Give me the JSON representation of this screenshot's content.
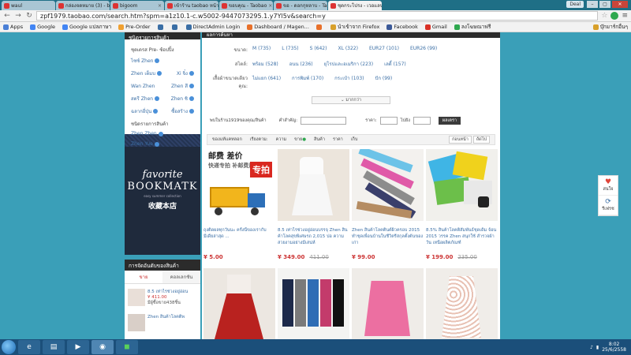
{
  "browser": {
    "tabs": [
      {
        "label": "waul",
        "active": false
      },
      {
        "label": "กล่องจดหมาย (3) - bigoom",
        "active": false
      },
      {
        "label": "bigoom",
        "active": false
      },
      {
        "label": "เข้าร้าน taobao หน้าร้านค้า",
        "active": false
      },
      {
        "label": "ขอบคุณ - Taobao",
        "active": false
      },
      {
        "label": "ขอ - ดอกกุหลาบ - Taobao",
        "active": false
      },
      {
        "label": "ชุดกระโปรง - เวอแลนด์น่า",
        "active": true
      }
    ],
    "user": "Deal",
    "url": "zpf1979.taobao.com/search.htm?spm=a1z10.1-c.w5002-9447073295.1.y7Yl5v&search=y",
    "bookmarks": [
      {
        "label": "Apps",
        "color": "#4a7fd6"
      },
      {
        "label": "Google",
        "color": "#4285f4"
      },
      {
        "label": "Google แปลภาษา",
        "color": "#4285f4"
      },
      {
        "label": "Pre-Order",
        "color": "#f0a030"
      },
      {
        "label": "",
        "color": "#3a6ea5"
      },
      {
        "label": "",
        "color": "#3a6ea5"
      },
      {
        "label": "DirectAdmin Login",
        "color": "#3a6ea5"
      },
      {
        "label": "Dashboard / Magen...",
        "color": "#e8702a"
      },
      {
        "label": "",
        "color": "#e8702a"
      },
      {
        "label": "นำเข้าจาก Firefox",
        "color": "#d8a02a"
      },
      {
        "label": "Facebook",
        "color": "#3b5998"
      },
      {
        "label": "Gmail",
        "color": "#d93025"
      },
      {
        "label": "ลงโฆษณาฟรี",
        "color": "#2fa84f"
      },
      {
        "label": "บุ๊กมาร์กอื่นๆ",
        "color": "#d8a02a"
      }
    ]
  },
  "sidebar": {
    "category_header": "ชนิดรายการสินค้า",
    "group1_title": "ชุดเดรส Pre- ซ้อปปิ้ง",
    "items": [
      {
        "label": "ไซซ์ Zhen",
        "has_icon": true
      },
      {
        "label": "Zhen เต็มบ",
        "has_icon": true
      },
      {
        "label": "Xi จิ๋ง",
        "has_icon": true
      },
      {
        "label": "Wan Zhen",
        "has_icon": false
      },
      {
        "label": "Zhen สี",
        "has_icon": true
      },
      {
        "label": "สตรี Zhen",
        "has_icon": true
      },
      {
        "label": "Zhen ชิ",
        "has_icon": true
      },
      {
        "label": "ฉลากยี่ปุ่น",
        "has_icon": true
      },
      {
        "label": "ซื้อสร้าง",
        "has_icon": true
      }
    ],
    "group2_title": "ชนิดรายการสินค้า",
    "group2_items": [
      {
        "label": "Zhen Zhen",
        "has_icon": true
      },
      {
        "label": "Zhen Yue",
        "has_icon": true
      }
    ],
    "banner": {
      "line1": "favorite",
      "line2": "BOOKMATK",
      "line3": "easy summer collection",
      "line4": "收藏本店"
    },
    "rank": {
      "header": "การจัดอันดับของสินค้า",
      "tab_active": "ขาย",
      "tab_inactive": "คอลเลกชัน",
      "items": [
        {
          "title": "8.5 เท่าไรช่วงอยู่อ่อน",
          "price": "¥ 411.00",
          "sold": "มีผู้ซื้อขาย438ชิ้น"
        },
        {
          "title": "Zhen สินค้าโลคติพ",
          "price": "",
          "sold": ""
        }
      ]
    }
  },
  "main": {
    "header": "ผลการค้นหา",
    "filters": [
      {
        "label": "ขนาด:",
        "values": [
          "M (735)",
          "L (735)",
          "S (642)",
          "XL (322)",
          "EUR27 (101)",
          "EUR26 (99)"
        ]
      },
      {
        "label": "สไตล์:",
        "values": [
          "พร้อม (528)",
          "อนน (236)",
          "ยุโรปและอเมริกา (223)",
          "เลดี้ (157)"
        ]
      },
      {
        "label": "เสื้อผ้าขนาดเดียวคุณ:",
        "values": [
          "ไม่แยก (641)",
          "การพิมพ์ (170)",
          "กระเป๋า (103)",
          "ปัก (99)"
        ]
      }
    ],
    "more_label": "มากกว่า",
    "search": {
      "shop_label": "พบในร้าน1919ของคุณ/สินค้า",
      "keyword_label": "คำสำคัญ:",
      "price_label": "ราคา:",
      "to_label": "ไปยัง",
      "button": "ผลเตรา"
    },
    "sort": {
      "label_all": "ของแท้แคทลอก",
      "label_by": "เรียงตาม:",
      "options": [
        "ความ",
        "ขาย",
        "สินค้า",
        "ราคา",
        "เก็บ"
      ],
      "pager": [
        "ก่อนหน้า",
        "ถัดไป"
      ]
    },
    "products": [
      {
        "title": "ถุงติดผลทุกวันนะ ครั้งนี้ของเรากับมีเดียล่าสุด ...",
        "price": "¥ 5.00",
        "old_price": "",
        "kind": "promo"
      },
      {
        "title": "8.5 เท่าไรช่วงอยู่อ่อนบรรจุ Zhen สินค้าโลคสุขพิเศษรถ 2,015 ปอ ความสวยงามอย่างมีเสน่ห์",
        "price": "¥ 349.00",
        "old_price": "411.00",
        "kind": "dress-white"
      },
      {
        "title": "Zhen สินค้าโลคตินต์ผิวครอบ 2015 ทำชุดเพื่อนบ้านในชีวิตรีสกุลตั้งต้นของเก่า",
        "price": "¥ 99.00",
        "old_price": "",
        "kind": "pants"
      },
      {
        "title": "8.5% สินค้าโลคติสัมพันธ์ชุดเดิม จ้อน 2015 วรรค Zhen สนุกใช้ สำรวจผ้าวัน เหนือผลิตภัณฑ์",
        "price": "¥ 199.00",
        "old_price": "235.00",
        "kind": "tops"
      },
      {
        "title": "",
        "price": "",
        "old_price": "",
        "kind": "dress-red"
      },
      {
        "title": "",
        "price": "",
        "old_price": "",
        "kind": "skirts"
      },
      {
        "title": "",
        "price": "",
        "old_price": "",
        "kind": "dress-pink"
      },
      {
        "title": "",
        "price": "",
        "old_price": "",
        "kind": "dress-print"
      }
    ]
  },
  "floater": [
    {
      "label": "สนใจ",
      "icon": "heart-icon"
    },
    {
      "label": "รีเฟรช",
      "icon": "refresh-icon"
    }
  ],
  "taskbar": {
    "time": "8:02",
    "date": "25/6/2558"
  }
}
